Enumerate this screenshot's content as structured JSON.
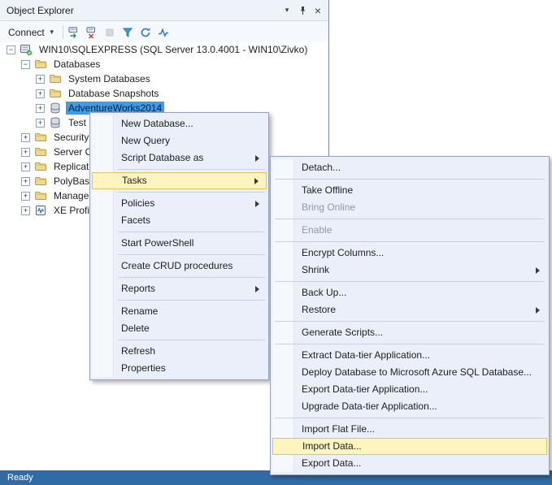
{
  "object_explorer": {
    "title": "Object Explorer",
    "toolbar": {
      "connect_label": "Connect",
      "icons": [
        {
          "name": "connect-server-icon",
          "disabled": false
        },
        {
          "name": "disconnect-server-icon",
          "disabled": false
        },
        {
          "name": "stop-icon",
          "disabled": true
        },
        {
          "name": "filter-icon",
          "disabled": false
        },
        {
          "name": "refresh-icon",
          "disabled": false
        },
        {
          "name": "activity-monitor-icon",
          "disabled": false
        }
      ]
    },
    "tree": [
      {
        "label": "WIN10\\SQLEXPRESS (SQL Server 13.0.4001 - WIN10\\Zivko)",
        "level": 0,
        "expander": "minus",
        "icon": "server-icon",
        "selected": false
      },
      {
        "label": "Databases",
        "level": 1,
        "expander": "minus",
        "icon": "folder-icon",
        "selected": false
      },
      {
        "label": "System Databases",
        "level": 2,
        "expander": "plus",
        "icon": "folder-icon",
        "selected": false
      },
      {
        "label": "Database Snapshots",
        "level": 2,
        "expander": "plus",
        "icon": "folder-icon",
        "selected": false
      },
      {
        "label": "AdventureWorks2014",
        "level": 2,
        "expander": "plus",
        "icon": "database-icon",
        "selected": true
      },
      {
        "label": "Test",
        "level": 2,
        "expander": "plus",
        "icon": "database-icon",
        "selected": false
      },
      {
        "label": "Security",
        "level": 1,
        "expander": "plus",
        "icon": "folder-icon",
        "selected": false
      },
      {
        "label": "Server Objects",
        "level": 1,
        "expander": "plus",
        "icon": "folder-icon",
        "selected": false
      },
      {
        "label": "Replication",
        "level": 1,
        "expander": "plus",
        "icon": "folder-icon",
        "selected": false
      },
      {
        "label": "PolyBase",
        "level": 1,
        "expander": "plus",
        "icon": "folder-icon",
        "selected": false
      },
      {
        "label": "Management",
        "level": 1,
        "expander": "plus",
        "icon": "folder-icon",
        "selected": false
      },
      {
        "label": "XE Profiler",
        "level": 1,
        "expander": "plus",
        "icon": "xe-profiler-icon",
        "selected": false
      }
    ]
  },
  "context_menu": {
    "items": [
      {
        "label": "New Database..."
      },
      {
        "label": "New Query"
      },
      {
        "label": "Script Database as",
        "submenu": true
      },
      {
        "separator": true
      },
      {
        "label": "Tasks",
        "submenu": true,
        "highlighted": true
      },
      {
        "separator": true
      },
      {
        "label": "Policies",
        "submenu": true
      },
      {
        "label": "Facets"
      },
      {
        "separator": true
      },
      {
        "label": "Start PowerShell"
      },
      {
        "separator": true
      },
      {
        "label": "Create CRUD procedures"
      },
      {
        "separator": true
      },
      {
        "label": "Reports",
        "submenu": true
      },
      {
        "separator": true
      },
      {
        "label": "Rename"
      },
      {
        "label": "Delete"
      },
      {
        "separator": true
      },
      {
        "label": "Refresh"
      },
      {
        "label": "Properties"
      }
    ]
  },
  "tasks_submenu": {
    "items": [
      {
        "label": "Detach..."
      },
      {
        "separator": true
      },
      {
        "label": "Take Offline"
      },
      {
        "label": "Bring Online",
        "disabled": true
      },
      {
        "separator": true
      },
      {
        "label": "Enable",
        "disabled": true
      },
      {
        "separator": true
      },
      {
        "label": "Encrypt Columns..."
      },
      {
        "label": "Shrink",
        "submenu": true
      },
      {
        "separator": true
      },
      {
        "label": "Back Up..."
      },
      {
        "label": "Restore",
        "submenu": true
      },
      {
        "separator": true
      },
      {
        "label": "Generate Scripts..."
      },
      {
        "separator": true
      },
      {
        "label": "Extract Data-tier Application..."
      },
      {
        "label": "Deploy Database to Microsoft Azure SQL Database..."
      },
      {
        "label": "Export Data-tier Application..."
      },
      {
        "label": "Upgrade Data-tier Application..."
      },
      {
        "separator": true
      },
      {
        "label": "Import Flat File..."
      },
      {
        "label": "Import Data...",
        "highlighted": true
      },
      {
        "label": "Export Data..."
      }
    ]
  },
  "statusbar": {
    "text": "Ready"
  },
  "colors": {
    "selection_blue": "#429adf",
    "menu_highlight_fill": "#fdf4bf",
    "menu_highlight_border": "#e5c365",
    "statusbar_blue": "#316ba6"
  }
}
